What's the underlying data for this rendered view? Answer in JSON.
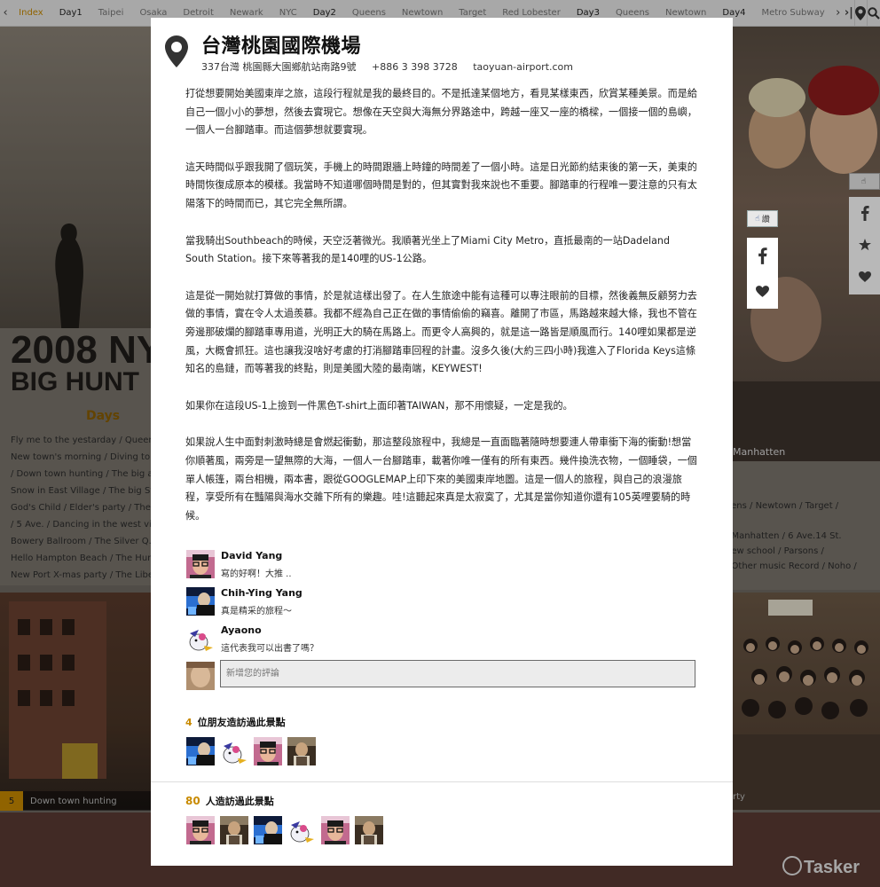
{
  "background": {
    "nav_items": [
      {
        "label": "Index",
        "type": "active"
      },
      {
        "label": "Day1",
        "type": "day"
      },
      {
        "label": "Taipei",
        "type": "place"
      },
      {
        "label": "Osaka",
        "type": "place"
      },
      {
        "label": "Detroit",
        "type": "place"
      },
      {
        "label": "Newark",
        "type": "place"
      },
      {
        "label": "NYC",
        "type": "place"
      },
      {
        "label": "Day2",
        "type": "day"
      },
      {
        "label": "Queens",
        "type": "place"
      },
      {
        "label": "Newtown",
        "type": "place"
      },
      {
        "label": "Target",
        "type": "place"
      },
      {
        "label": "Red Lobester",
        "type": "place"
      },
      {
        "label": "Day3",
        "type": "day"
      },
      {
        "label": "Queens",
        "type": "place"
      },
      {
        "label": "Newtown",
        "type": "place"
      },
      {
        "label": "Day4",
        "type": "day"
      },
      {
        "label": "Metro Subway",
        "type": "place"
      }
    ],
    "title_line1": "2008 NY",
    "title_line2": "BIG HUNT",
    "days_label": "Days",
    "left_links": [
      "Fly me to the yestarday  /  Queens' ...",
      "New town's morning  /  Diving to M...",
      "/  Down town hunting  /  The big ap...",
      "Snow in East Village  /  The big Sto...",
      "God's Child  /  Elder's party  /  The ...",
      "/  5 Ave.  /  Dancing in the west villa...",
      "Bowery Ballroom  /  The Silver Q...",
      "Hello Hampton Beach  /  The Hunt...",
      "New Port X-mas party  /  The Liber..."
    ],
    "right_caption": "Manhatten",
    "right_links": [
      "eens / Newtown / Target /",
      "",
      "/ Manhatten / 6 Ave.14 St.",
      "new school / Parsons /",
      "/ Other music Record / Noho /"
    ],
    "bottom_caption_num": "5",
    "bottom_caption": "Down town hunting",
    "right_bottom_caption": "rty",
    "logo": "Tasker",
    "like_label": "讚"
  },
  "place": {
    "title": "台灣桃園國際機場",
    "address": "337台灣 桃園縣大園鄉航站南路9號",
    "phone": "+886 3 398 3728",
    "website": "taoyuan-airport.com"
  },
  "article": {
    "paragraphs": [
      "打從想要開始美國東岸之旅，這段行程就是我的最終目的。不是抵達某個地方，看見某樣東西，欣賞某種美景。而是給自己一個小小的夢想，然後去實現它。想像在天空與大海無分界路途中，跨越一座又一座的橋樑，一個接一個的島嶼，一個人一台腳踏車。而這個夢想就要實現。",
      "這天時間似乎跟我開了個玩笑，手機上的時間跟牆上時鐘的時間差了一個小時。這是日光節約結束後的第一天，美東的時間恢復成原本的模樣。我當時不知道哪個時間是對的，但其實對我來說也不重要。腳踏車的行程唯一要注意的只有太陽落下的時間而已，其它完全無所謂。",
      "當我騎出Southbeach的時候，天空泛著微光。我順著光坐上了Miami City Metro，直抵最南的一站Dadeland South Station。接下來等著我的是140哩的US-1公路。",
      "這是從一開始就打算做的事情，於是就這樣出發了。在人生旅途中能有這種可以專注眼前的目標，然後義無反顧努力去做的事情，實在令人太過羨慕。我都不經為自己正在做的事情偷偷的竊喜。離開了市區，馬路越來越大條，我也不管在旁邊那破爛的腳踏車專用道，光明正大的騎在馬路上。而更令人高興的，就是這一路皆是順風而行。140哩如果都是逆風，大概會抓狂。這也讓我沒啥好考慮的打消腳踏車回程的計畫。沒多久後(大約三四小時)我進入了Florida Keys這條知名的島鏈，而等著我的終點，則是美國大陸的最南端，KEYWEST!",
      "如果你在這段US-1上撿到一件黑色T-shirt上面印著TAIWAN，那不用懷疑，一定是我的。",
      "如果說人生中面對刺激時總是會燃起衝動，那這整段旅程中，我總是一直面臨著隨時想要連人帶車衝下海的衝動!想當你順著風，兩旁是一望無際的大海，一個人一台腳踏車，載著你唯一僅有的所有東西。幾件換洗衣物，一個睡袋，一個單人帳篷，兩台相機，兩本書，跟從GOOGLEMAP上印下來的美國東岸地圖。這是一個人的旅程，與自己的浪漫旅程，享受所有在豔陽與海水交雜下所有的樂趣。哇!這聽起來真是太寂寞了，尤其是當你知道你還有105英哩要騎的時候。"
    ]
  },
  "comments": [
    {
      "name": "David Yang",
      "text": "寫的好啊！大推 ..",
      "avatar": "avatar-glasses"
    },
    {
      "name": "Chih-Ying Yang",
      "text": "真是精采的旅程～",
      "avatar": "avatar-blue"
    },
    {
      "name": "Ayaono",
      "text": "這代表我可以出書了嗎？",
      "avatar": "avatar-cartoon"
    }
  ],
  "new_comment": {
    "placeholder": "新增您的評論"
  },
  "friends": {
    "count": "4",
    "label": "位朋友造訪過此景點",
    "avatars": [
      "avatar-blue",
      "avatar-cartoon",
      "avatar-glasses",
      "avatar-brown"
    ]
  },
  "visitors": {
    "count": "80",
    "label": "人造訪過此景點",
    "avatars": [
      "avatar-glasses",
      "avatar-brown",
      "avatar-blue",
      "avatar-cartoon",
      "avatar-glasses",
      "avatar-brown"
    ]
  },
  "colors": {
    "accent": "#c88a00",
    "modal_bg": "#ffffff",
    "input_bg": "#ececec"
  },
  "icons": {
    "pin": "map-pin-icon",
    "facebook": "facebook-icon",
    "heart": "heart-icon",
    "star": "star-icon",
    "like": "thumbs-up-icon"
  }
}
